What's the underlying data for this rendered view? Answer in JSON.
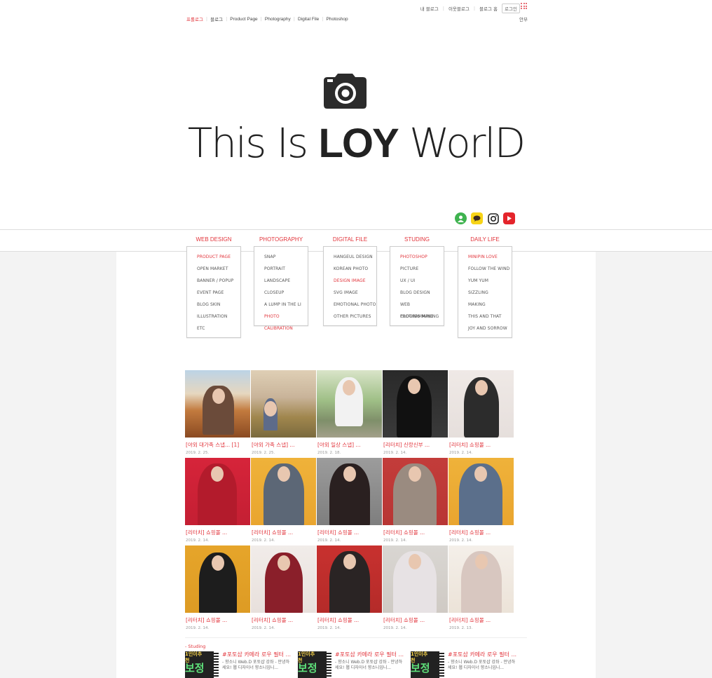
{
  "utility": {
    "my_blog": "내 블로그",
    "neighbor_blog": "이웃블로그",
    "blog_home": "블로그 홈",
    "login": "로그인"
  },
  "blog_nav": {
    "items": [
      "프롤로그",
      "블로그",
      "Product Page",
      "Photography",
      "Digital File",
      "Photoshop"
    ],
    "right_link": "안부"
  },
  "hero": {
    "title_thin1": "This Is ",
    "title_bold": "LOY",
    "title_thin2": " WorlD"
  },
  "social": [
    "blog-icon",
    "talk-icon",
    "instagram-icon",
    "youtube-icon"
  ],
  "colors": {
    "accent": "#e2353c"
  },
  "menu": [
    {
      "head": "WEB DESIGN",
      "items": [
        "PRODUCT PAGE",
        "OPEN MARKET",
        "BANNER / POPUP",
        "EVENT PAGE",
        "BLOG SKIN",
        "ILLUSTRATION",
        "ETC"
      ],
      "red": [
        0
      ]
    },
    {
      "head": "PHOTOGRAPHY",
      "items": [
        "SNAP",
        "PORTRAIT",
        "LANDSCAPE",
        "CLOSEUP",
        "A LUMP IN THE LI",
        "PHOTO CALIBRATION"
      ],
      "red": [
        5
      ]
    },
    {
      "head": "DIGITAL FILE",
      "items": [
        "HANGEUL DESIGN",
        "KOREAN PHOTO",
        "DESIGN IMAGE",
        "SVG IMAGE",
        "EMOTIONAL PHOTO",
        "OTHER PICTURES"
      ],
      "red": [
        2
      ]
    },
    {
      "head": "STUDING",
      "items": [
        "PHOTOSHOP",
        "PICTURE",
        "UX / UI",
        "BLOG DESIGN",
        "WEB PROGRAMMING",
        "CLOTHES MAKING"
      ],
      "red": [
        0
      ]
    },
    {
      "head": "DAILY LIFE",
      "items": [
        "MINIPIN LOVE",
        "FOLLOW THE WIND",
        "YUM YUM",
        "SIZZLING",
        "MAKING",
        "THIS AND THAT",
        "JOY AND SORROW"
      ],
      "red": [
        0
      ]
    }
  ],
  "posts": [
    {
      "title": "[야외 대가족 스냅... [1]",
      "date": "2019. 2. 25."
    },
    {
      "title": "[야외 가족 스냅] ...",
      "date": "2019. 2. 25."
    },
    {
      "title": "[야외 일상 스냅] ...",
      "date": "2019. 2. 18."
    },
    {
      "title": "[리터치] 신랑신부 ...",
      "date": "2019. 2. 14."
    },
    {
      "title": "[리터치] 쇼핑몰 ...",
      "date": "2019. 2. 14."
    },
    {
      "title": "[리터치] 쇼핑몰 ...",
      "date": "2019. 2. 14."
    },
    {
      "title": "[리터치] 쇼핑몰 ...",
      "date": "2019. 2. 14."
    },
    {
      "title": "[리터치] 쇼핑몰 ...",
      "date": "2019. 2. 14."
    },
    {
      "title": "[리터치] 쇼핑몰 ...",
      "date": "2019. 2. 14."
    },
    {
      "title": "[리터치] 쇼핑몰 ...",
      "date": "2019. 2. 14."
    },
    {
      "title": "[리터치] 쇼핑몰 ...",
      "date": "2019. 2. 14."
    },
    {
      "title": "[리터치] 쇼핑몰 ...",
      "date": "2019. 2. 14."
    },
    {
      "title": "[리터치] 쇼핑몰 ...",
      "date": "2019. 2. 14."
    },
    {
      "title": "[리터치] 쇼핑몰 ...",
      "date": "2019. 2. 14."
    },
    {
      "title": "[리터치] 쇼핑몰 ...",
      "date": "2019. 2. 13."
    }
  ],
  "studying": {
    "label": "- Studing",
    "items": [
      {
        "title": "#포토샵 카메라 로우 필터 ...",
        "desc": "- 향소니 Web.D 포토샵 강좌 - 안녕하세요! 웹 디자이너 향소니입니...",
        "thumb_top": "1인이추천",
        "thumb_big": "보정"
      },
      {
        "title": "#포토샵 카메라 로우 필터 ...",
        "desc": "- 향소니 Web.D 포토샵 강좌 - 안녕하세요! 웹 디자이너 향소니입니...",
        "thumb_top": "1인이추천",
        "thumb_big": "보정"
      },
      {
        "title": "#포토샵 카메라 로우 필터 ...",
        "desc": "- 향소니 Web.D 포토샵 강좌 - 안녕하세요! 웹 디자이너 향소니입니...",
        "thumb_top": "1인이추천",
        "thumb_big": "보정"
      }
    ]
  }
}
